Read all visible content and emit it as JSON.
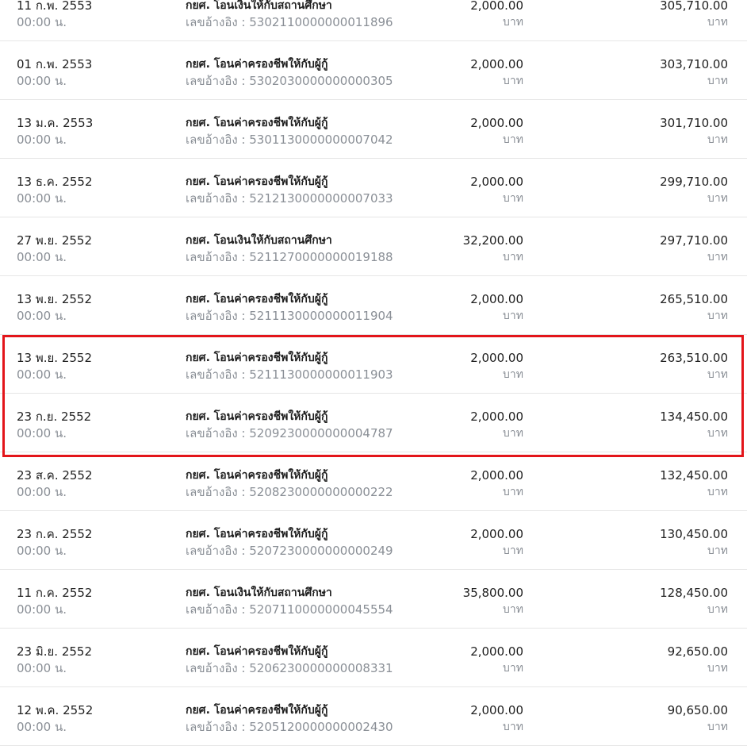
{
  "transactions": [
    {
      "date": "11 ก.พ. 2553",
      "time": "00:00 น.",
      "description": "กยศ. โอนเงินให้กับสถานศึกษา",
      "reference": "เลขอ้างอิง : 5302110000000011896",
      "amount": "2,000.00",
      "amount_unit": "บาท",
      "balance": "305,710.00",
      "balance_unit": "บาท"
    },
    {
      "date": "01 ก.พ. 2553",
      "time": "00:00 น.",
      "description": "กยศ. โอนค่าครองชีพให้กับผู้กู้",
      "reference": "เลขอ้างอิง : 5302030000000000305",
      "amount": "2,000.00",
      "amount_unit": "บาท",
      "balance": "303,710.00",
      "balance_unit": "บาท"
    },
    {
      "date": "13 ม.ค. 2553",
      "time": "00:00 น.",
      "description": "กยศ. โอนค่าครองชีพให้กับผู้กู้",
      "reference": "เลขอ้างอิง : 5301130000000007042",
      "amount": "2,000.00",
      "amount_unit": "บาท",
      "balance": "301,710.00",
      "balance_unit": "บาท"
    },
    {
      "date": "13 ธ.ค. 2552",
      "time": "00:00 น.",
      "description": "กยศ. โอนค่าครองชีพให้กับผู้กู้",
      "reference": "เลขอ้างอิง : 5212130000000007033",
      "amount": "2,000.00",
      "amount_unit": "บาท",
      "balance": "299,710.00",
      "balance_unit": "บาท"
    },
    {
      "date": "27 พ.ย. 2552",
      "time": "00:00 น.",
      "description": "กยศ. โอนเงินให้กับสถานศึกษา",
      "reference": "เลขอ้างอิง : 5211270000000019188",
      "amount": "32,200.00",
      "amount_unit": "บาท",
      "balance": "297,710.00",
      "balance_unit": "บาท"
    },
    {
      "date": "13 พ.ย. 2552",
      "time": "00:00 น.",
      "description": "กยศ. โอนค่าครองชีพให้กับผู้กู้",
      "reference": "เลขอ้างอิง : 5211130000000011904",
      "amount": "2,000.00",
      "amount_unit": "บาท",
      "balance": "265,510.00",
      "balance_unit": "บาท"
    },
    {
      "date": "13 พ.ย. 2552",
      "time": "00:00 น.",
      "description": "กยศ. โอนค่าครองชีพให้กับผู้กู้",
      "reference": "เลขอ้างอิง : 5211130000000011903",
      "amount": "2,000.00",
      "amount_unit": "บาท",
      "balance": "263,510.00",
      "balance_unit": "บาท"
    },
    {
      "date": "23 ก.ย. 2552",
      "time": "00:00 น.",
      "description": "กยศ. โอนค่าครองชีพให้กับผู้กู้",
      "reference": "เลขอ้างอิง : 5209230000000004787",
      "amount": "2,000.00",
      "amount_unit": "บาท",
      "balance": "134,450.00",
      "balance_unit": "บาท"
    },
    {
      "date": "23 ส.ค. 2552",
      "time": "00:00 น.",
      "description": "กยศ. โอนค่าครองชีพให้กับผู้กู้",
      "reference": "เลขอ้างอิง : 5208230000000000222",
      "amount": "2,000.00",
      "amount_unit": "บาท",
      "balance": "132,450.00",
      "balance_unit": "บาท"
    },
    {
      "date": "23 ก.ค. 2552",
      "time": "00:00 น.",
      "description": "กยศ. โอนค่าครองชีพให้กับผู้กู้",
      "reference": "เลขอ้างอิง : 5207230000000000249",
      "amount": "2,000.00",
      "amount_unit": "บาท",
      "balance": "130,450.00",
      "balance_unit": "บาท"
    },
    {
      "date": "11 ก.ค. 2552",
      "time": "00:00 น.",
      "description": "กยศ. โอนเงินให้กับสถานศึกษา",
      "reference": "เลขอ้างอิง : 5207110000000045554",
      "amount": "35,800.00",
      "amount_unit": "บาท",
      "balance": "128,450.00",
      "balance_unit": "บาท"
    },
    {
      "date": "23 มิ.ย. 2552",
      "time": "00:00 น.",
      "description": "กยศ. โอนค่าครองชีพให้กับผู้กู้",
      "reference": "เลขอ้างอิง : 5206230000000008331",
      "amount": "2,000.00",
      "amount_unit": "บาท",
      "balance": "92,650.00",
      "balance_unit": "บาท"
    },
    {
      "date": "12 พ.ค. 2552",
      "time": "00:00 น.",
      "description": "กยศ. โอนค่าครองชีพให้กับผู้กู้",
      "reference": "เลขอ้างอิง : 5205120000000002430",
      "amount": "2,000.00",
      "amount_unit": "บาท",
      "balance": "90,650.00",
      "balance_unit": "บาท"
    }
  ],
  "highlight": {
    "color": "#e3151a"
  }
}
